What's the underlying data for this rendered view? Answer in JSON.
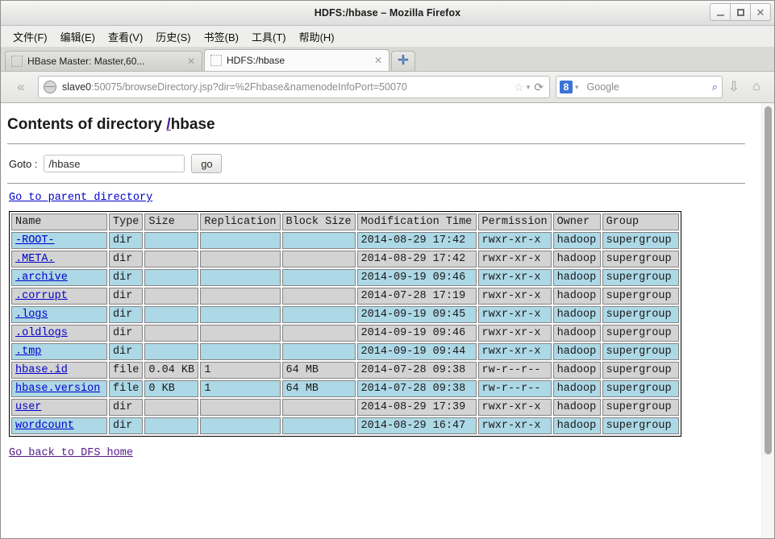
{
  "window": {
    "title": "HDFS:/hbase – Mozilla Firefox",
    "minimize_label": "",
    "maximize_label": "",
    "close_label": "✕"
  },
  "menubar": {
    "items": [
      {
        "text": "文件(",
        "key": "F",
        "tail": ")"
      },
      {
        "text": "编辑(",
        "key": "E",
        "tail": ")"
      },
      {
        "text": "查看(",
        "key": "V",
        "tail": ")"
      },
      {
        "text": "历史(",
        "key": "S",
        "tail": ")"
      },
      {
        "text": "书签(",
        "key": "B",
        "tail": ")"
      },
      {
        "text": "工具(",
        "key": "T",
        "tail": ")"
      },
      {
        "text": "帮助(",
        "key": "H",
        "tail": ")"
      }
    ],
    "labels": [
      "文件(F)",
      "编辑(E)",
      "查看(V)",
      "历史(S)",
      "书签(B)",
      "工具(T)",
      "帮助(H)"
    ]
  },
  "tabs": [
    {
      "label": "HBase Master: Master,60...",
      "active": false,
      "close": "✕"
    },
    {
      "label": "HDFS:/hbase",
      "active": true,
      "close": "✕"
    }
  ],
  "newtab_label": "✛",
  "navbar": {
    "back_icon": "«",
    "url_host": "slave0",
    "url_rest": ":50075/browseDirectory.jsp?dir=%2Fhbase&namenodeInfoPort=50070",
    "star_icon": "☆",
    "caret_icon": "▾",
    "reload_icon": "⟳",
    "search_engine": "8",
    "search_placeholder": "Google",
    "search_caret": "▾",
    "search_icon": "⌕",
    "download_icon": "⇩",
    "home_icon": "⌂"
  },
  "page": {
    "title_prefix": "Contents of directory ",
    "title_slash": "/",
    "title_dir": "hbase",
    "goto_label": "Goto :",
    "goto_value": "/hbase",
    "goto_placeholder": "",
    "goto_button": "go",
    "parent_link": "Go to parent directory",
    "dfs_home_link": "Go back to DFS home"
  },
  "table": {
    "columns": [
      "Name",
      "Type",
      "Size",
      "Replication",
      "Block Size",
      "Modification Time",
      "Permission",
      "Owner",
      "Group"
    ],
    "rows": [
      {
        "name": "-ROOT-",
        "type": "dir",
        "size": "",
        "replication": "",
        "block_size": "",
        "mtime": "2014-08-29 17:42",
        "permission": "rwxr-xr-x",
        "owner": "hadoop",
        "group": "supergroup"
      },
      {
        "name": ".META.",
        "type": "dir",
        "size": "",
        "replication": "",
        "block_size": "",
        "mtime": "2014-08-29 17:42",
        "permission": "rwxr-xr-x",
        "owner": "hadoop",
        "group": "supergroup"
      },
      {
        "name": ".archive",
        "type": "dir",
        "size": "",
        "replication": "",
        "block_size": "",
        "mtime": "2014-09-19 09:46",
        "permission": "rwxr-xr-x",
        "owner": "hadoop",
        "group": "supergroup"
      },
      {
        "name": ".corrupt",
        "type": "dir",
        "size": "",
        "replication": "",
        "block_size": "",
        "mtime": "2014-07-28 17:19",
        "permission": "rwxr-xr-x",
        "owner": "hadoop",
        "group": "supergroup"
      },
      {
        "name": ".logs",
        "type": "dir",
        "size": "",
        "replication": "",
        "block_size": "",
        "mtime": "2014-09-19 09:45",
        "permission": "rwxr-xr-x",
        "owner": "hadoop",
        "group": "supergroup"
      },
      {
        "name": ".oldlogs",
        "type": "dir",
        "size": "",
        "replication": "",
        "block_size": "",
        "mtime": "2014-09-19 09:46",
        "permission": "rwxr-xr-x",
        "owner": "hadoop",
        "group": "supergroup"
      },
      {
        "name": ".tmp",
        "type": "dir",
        "size": "",
        "replication": "",
        "block_size": "",
        "mtime": "2014-09-19 09:44",
        "permission": "rwxr-xr-x",
        "owner": "hadoop",
        "group": "supergroup"
      },
      {
        "name": "hbase.id",
        "type": "file",
        "size": "0.04 KB",
        "replication": "1",
        "block_size": "64 MB",
        "mtime": "2014-07-28 09:38",
        "permission": "rw-r--r--",
        "owner": "hadoop",
        "group": "supergroup"
      },
      {
        "name": "hbase.version",
        "type": "file",
        "size": "0 KB",
        "replication": "1",
        "block_size": "64 MB",
        "mtime": "2014-07-28 09:38",
        "permission": "rw-r--r--",
        "owner": "hadoop",
        "group": "supergroup"
      },
      {
        "name": "user",
        "type": "dir",
        "size": "",
        "replication": "",
        "block_size": "",
        "mtime": "2014-08-29 17:39",
        "permission": "rwxr-xr-x",
        "owner": "hadoop",
        "group": "supergroup"
      },
      {
        "name": "wordcount",
        "type": "dir",
        "size": "",
        "replication": "",
        "block_size": "",
        "mtime": "2014-08-29 16:47",
        "permission": "rwxr-xr-x",
        "owner": "hadoop",
        "group": "supergroup"
      }
    ]
  },
  "colors": {
    "row_odd": "#add8e6",
    "row_even": "#d3d3d3",
    "link": "#0000cc",
    "visited_link": "#551a8b",
    "header_bg": "#d3d3d3"
  }
}
